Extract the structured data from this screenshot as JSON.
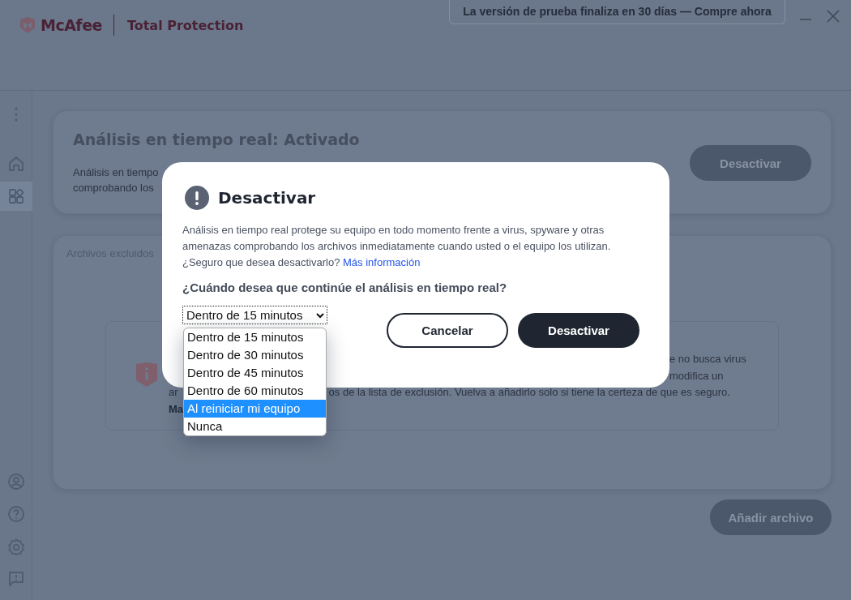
{
  "header": {
    "brand": "McAfee",
    "product": "Total Protection",
    "trial_banner": "La versión de prueba finaliza en 30 días — Compre ahora"
  },
  "sidebar": {
    "top_items": [
      {
        "kind": "home",
        "selected": false
      },
      {
        "kind": "apps",
        "selected": true
      }
    ],
    "bottom_items": [
      {
        "kind": "account",
        "selected": false
      },
      {
        "kind": "help",
        "selected": false
      },
      {
        "kind": "settings",
        "selected": false
      },
      {
        "kind": "feedback",
        "selected": false
      }
    ]
  },
  "realtime_card": {
    "title": "Análisis en tiempo real: Activado",
    "description_lines": [
      "Análisis en tiempo",
      "comprobando los"
    ],
    "button": "Desactivar"
  },
  "excluded_card": {
    "title": "Archivos excluidos",
    "info_lines": [
      {
        "parts": [
          "e no busca virus"
        ]
      },
      {
        "parts": [
          "modifica un"
        ]
      },
      {
        "parts": [
          "ar",
          "os de la lista de exclusión. Vuelva a añadirlo solo si tiene la certeza de que es seguro."
        ]
      },
      {
        "parts": [
          "Ma"
        ]
      }
    ]
  },
  "add_button": "Añadir archivo",
  "dialog": {
    "title": "Desactivar",
    "body": "Análisis en tiempo real protege su equipo en todo momento frente a virus, spyware y otras amenazas comprobando los archivos inmediatamente cuando usted o el equipo los utilizan.",
    "confirm": "¿Seguro que desea desactivarlo?",
    "link": "Más información",
    "question": "¿Cuándo desea que continúe el análisis en tiempo real?",
    "select": {
      "value": "Dentro de 15 minutos",
      "expanded": true,
      "options": [
        {
          "label": "Dentro de 15 minutos",
          "highlighted": false
        },
        {
          "label": "Dentro de 30 minutos",
          "highlighted": false
        },
        {
          "label": "Dentro de 45 minutos",
          "highlighted": false
        },
        {
          "label": "Dentro de 60 minutos",
          "highlighted": false
        },
        {
          "label": "Al reiniciar mi equipo",
          "highlighted": true
        },
        {
          "label": "Nunca",
          "highlighted": false
        }
      ]
    },
    "buttons": [
      {
        "label": "Cancelar",
        "kind": "secondary"
      },
      {
        "label": "Desactivar",
        "kind": "primary"
      }
    ]
  }
}
